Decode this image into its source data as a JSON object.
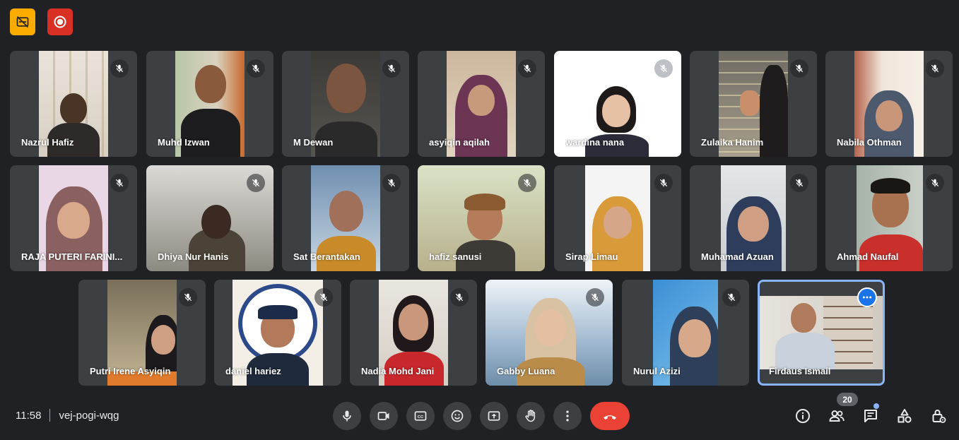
{
  "colors": {
    "background": "#202124",
    "tile": "#3c4043",
    "caption_badge": "#f9ab00",
    "record_badge": "#d93025",
    "end_call": "#ea4335",
    "active_speaker": "#8ab4f8"
  },
  "status_badges": [
    {
      "icon": "captions-off-icon"
    },
    {
      "icon": "record-icon"
    }
  ],
  "participants": [
    {
      "name": "Nazrul Hafiz",
      "muted": true
    },
    {
      "name": "Muhd Izwan",
      "muted": true
    },
    {
      "name": "M Dewan",
      "muted": true
    },
    {
      "name": "asyiqin aqilah",
      "muted": true
    },
    {
      "name": "wardina nana",
      "muted": true
    },
    {
      "name": "Zulaika Hanim",
      "muted": true
    },
    {
      "name": "Nabila Othman",
      "muted": true
    },
    {
      "name": "RAJA PUTERI FARINI...",
      "muted": true
    },
    {
      "name": "Dhiya Nur Hanis",
      "muted": true
    },
    {
      "name": "Sat Berantakan",
      "muted": true
    },
    {
      "name": "hafiz sanusi",
      "muted": true
    },
    {
      "name": "Sirap Limau",
      "muted": true
    },
    {
      "name": "Muhamad Azuan",
      "muted": true
    },
    {
      "name": "Ahmad Naufal",
      "muted": true
    },
    {
      "name": "Putri Irene Asyiqin",
      "muted": true
    },
    {
      "name": "daniel hariez",
      "muted": true
    },
    {
      "name": "Nadia Mohd Jani",
      "muted": true
    },
    {
      "name": "Gabby Luana",
      "muted": true
    },
    {
      "name": "Nurul Azizi",
      "muted": true
    },
    {
      "name": "Firdaus Ismail",
      "muted": false,
      "self": true
    }
  ],
  "meeting": {
    "time": "11:58",
    "code": "vej-pogi-wqg"
  },
  "controls": [
    {
      "icon": "mic-icon"
    },
    {
      "icon": "camera-icon"
    },
    {
      "icon": "closed-captions-icon"
    },
    {
      "icon": "emoji-icon"
    },
    {
      "icon": "present-screen-icon"
    },
    {
      "icon": "raise-hand-icon"
    },
    {
      "icon": "more-options-icon"
    },
    {
      "icon": "end-call-icon"
    }
  ],
  "side_controls": [
    {
      "icon": "info-icon"
    },
    {
      "icon": "people-icon"
    },
    {
      "icon": "chat-icon"
    },
    {
      "icon": "activities-icon"
    },
    {
      "icon": "host-controls-icon"
    }
  ],
  "people_count": "20"
}
